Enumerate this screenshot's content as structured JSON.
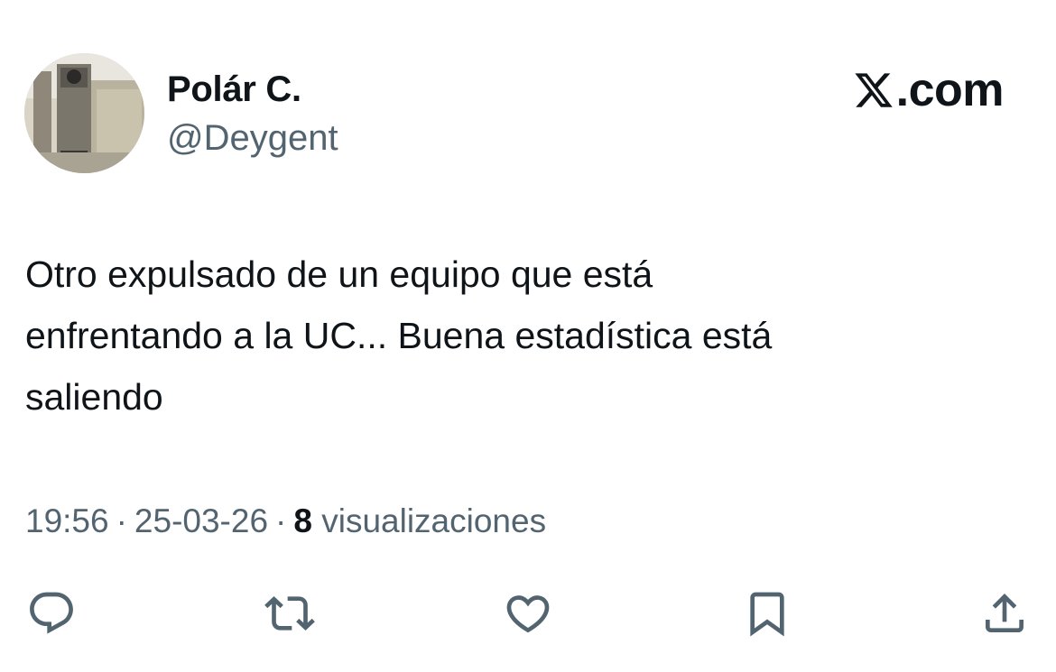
{
  "author": {
    "display_name": "Polár C.",
    "handle": "@Deygent",
    "avatar_icon": "profile-photo"
  },
  "brand": {
    "label": ".com",
    "logo_icon": "x-logo-icon"
  },
  "tweet": {
    "text": "Otro expulsado de un equipo que está\nenfrentando a la UC... Buena estadística está\nsaliendo"
  },
  "meta": {
    "time": "19:56",
    "separator": "·",
    "date": "25-03-26",
    "views_count": "8",
    "views_label": "visualizaciones"
  },
  "actions": {
    "reply_icon": "reply-icon",
    "retweet_icon": "retweet-icon",
    "like_icon": "like-heart-icon",
    "bookmark_icon": "bookmark-icon",
    "share_icon": "share-icon"
  },
  "colors": {
    "primary_text": "#0f1419",
    "secondary_text": "#536471",
    "background": "#ffffff"
  }
}
